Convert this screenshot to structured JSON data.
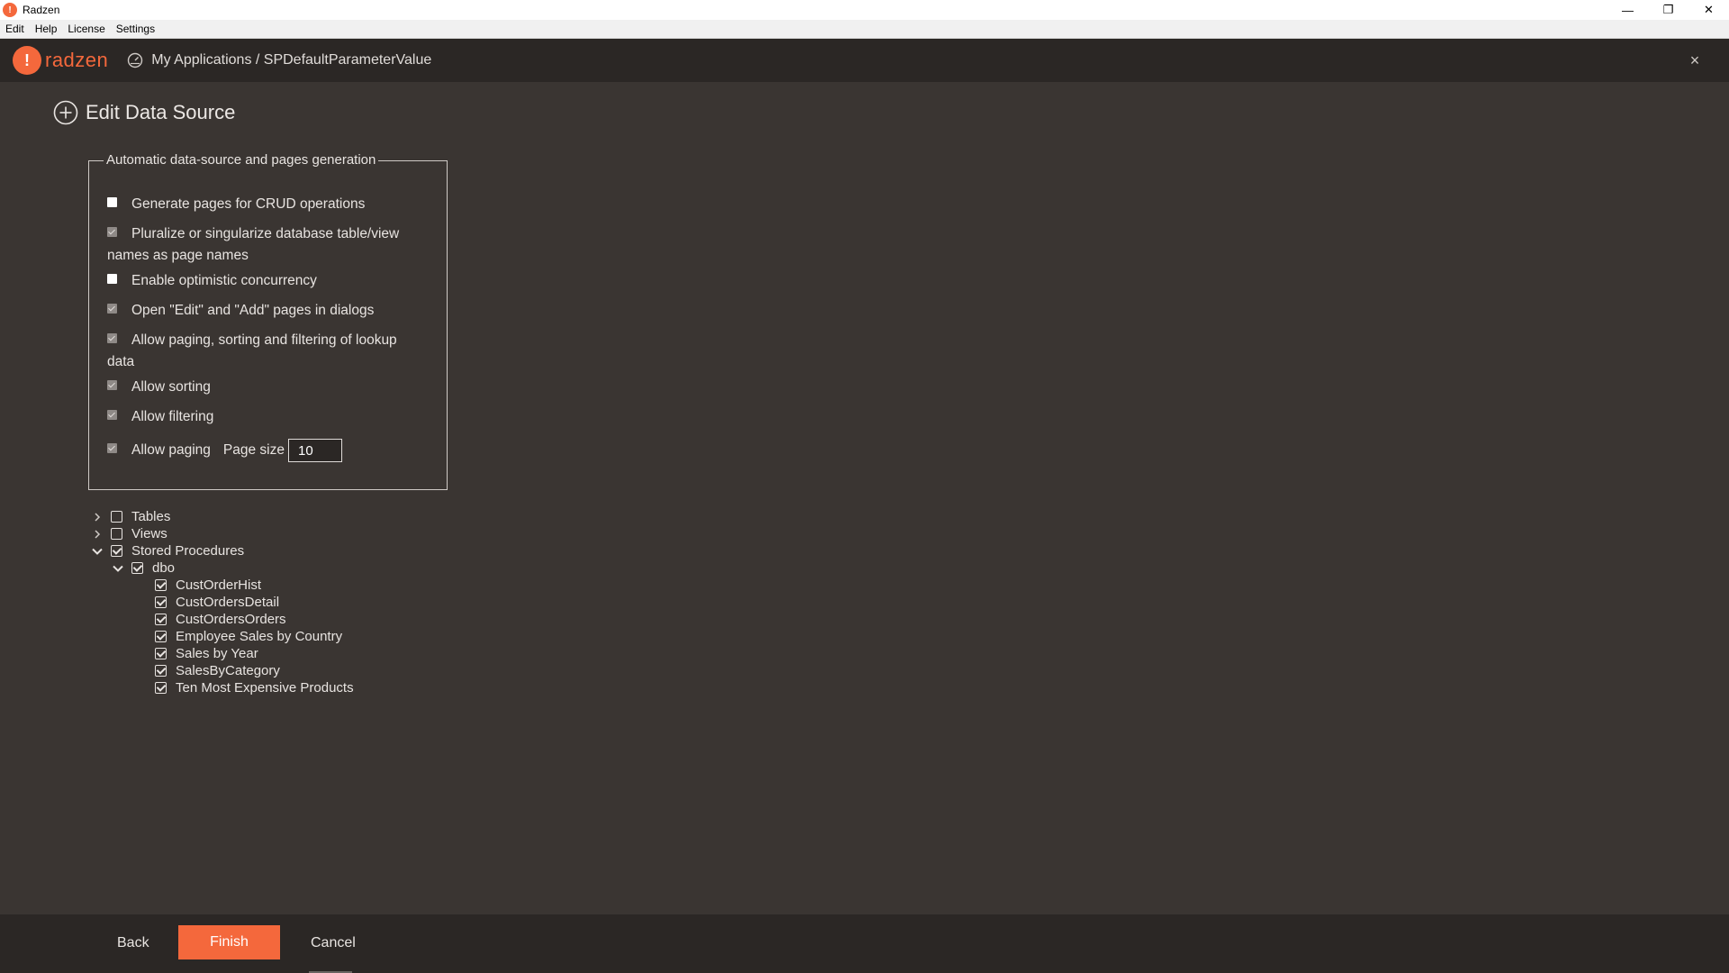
{
  "window": {
    "title": "Radzen",
    "controls": {
      "minimize": "—",
      "restore": "❐",
      "close": "✕"
    }
  },
  "menu": [
    "Edit",
    "Help",
    "License",
    "Settings"
  ],
  "header": {
    "logo_text": "radzen",
    "breadcrumb": "My Applications / SPDefaultParameterValue",
    "close_glyph": "×"
  },
  "page": {
    "title": "Edit Data Source"
  },
  "generation": {
    "legend": "Automatic data-source and pages generation",
    "options": [
      {
        "label": "Generate pages for CRUD operations",
        "checked": false,
        "disabled": false
      },
      {
        "label": "Pluralize or singularize database table/view names as page names",
        "checked": true,
        "disabled": true
      },
      {
        "label": "Enable optimistic concurrency",
        "checked": false,
        "disabled": false
      },
      {
        "label": "Open \"Edit\" and \"Add\" pages in dialogs",
        "checked": true,
        "disabled": true
      },
      {
        "label": "Allow paging, sorting and filtering of lookup data",
        "checked": true,
        "disabled": true
      },
      {
        "label": "Allow sorting",
        "checked": true,
        "disabled": true
      },
      {
        "label": "Allow filtering",
        "checked": true,
        "disabled": true
      },
      {
        "label": "Allow paging",
        "checked": true,
        "disabled": true
      }
    ],
    "page_size_label": "Page size",
    "page_size_value": "10"
  },
  "tree": {
    "tables": {
      "label": "Tables",
      "expanded": false,
      "checked": false
    },
    "views": {
      "label": "Views",
      "expanded": false,
      "checked": false
    },
    "stored_procedures": {
      "label": "Stored Procedures",
      "expanded": true,
      "checked": true,
      "schema": {
        "label": "dbo",
        "expanded": true,
        "checked": true,
        "items": [
          "CustOrderHist",
          "CustOrdersDetail",
          "CustOrdersOrders",
          "Employee Sales by Country",
          "Sales by Year",
          "SalesByCategory",
          "Ten Most Expensive Products"
        ]
      }
    }
  },
  "footer": {
    "back_label": "Back",
    "finish_label": "Finish",
    "cancel_label": "Cancel"
  },
  "colors": {
    "accent": "#f4683c",
    "background": "#3a3532",
    "header": "#2b2725"
  }
}
